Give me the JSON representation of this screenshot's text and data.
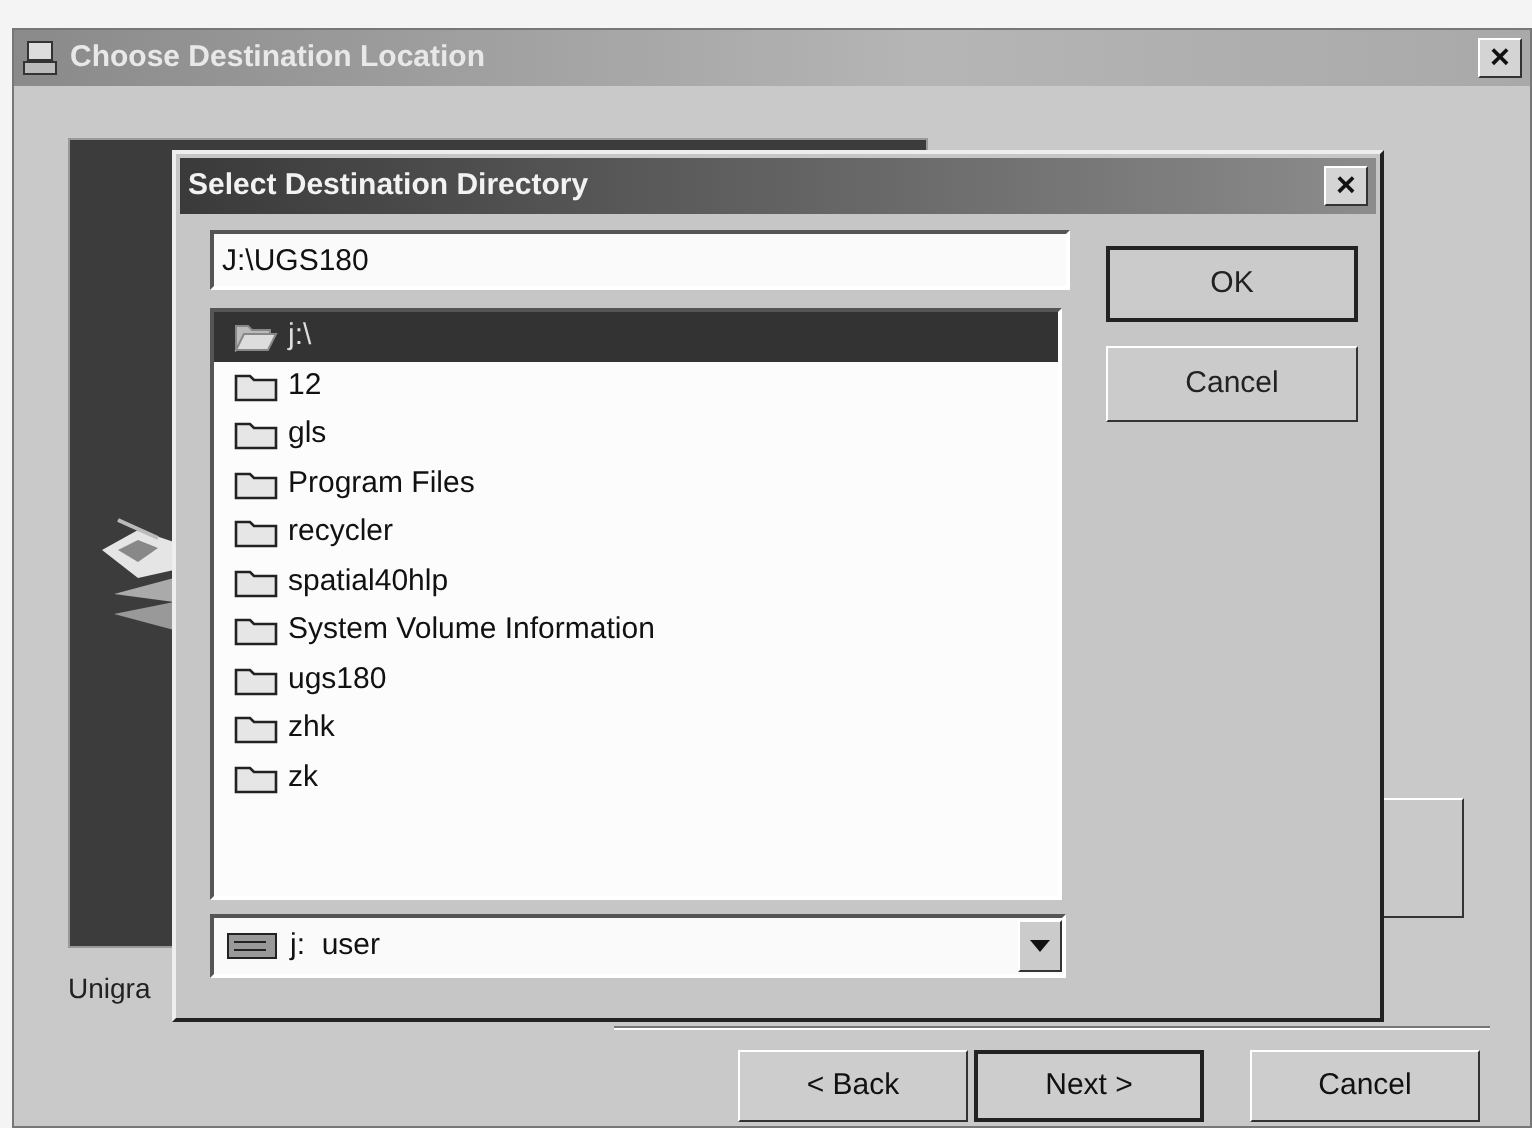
{
  "window": {
    "title": "Choose Destination Location",
    "close": "×"
  },
  "installer": {
    "caption": "Unigra",
    "buttons": [
      {
        "label": "< Back",
        "default": false
      },
      {
        "label": "Next >",
        "default": true
      },
      {
        "label": "Cancel",
        "default": false
      }
    ]
  },
  "dialog": {
    "title": "Select Destination Directory",
    "close": "×",
    "path": "J:\\UGS180",
    "buttons": [
      {
        "label": "OK",
        "default": true
      },
      {
        "label": "Cancel",
        "default": false
      }
    ],
    "folders": [
      {
        "name": "j:\\",
        "selected": true,
        "children": [
          {
            "name": "12",
            "selected": false
          },
          {
            "name": "gls",
            "selected": false
          },
          {
            "name": "Program Files",
            "selected": false
          },
          {
            "name": "recycler",
            "selected": false
          },
          {
            "name": "spatial40hlp",
            "selected": false
          },
          {
            "name": "System Volume Information",
            "selected": false
          },
          {
            "name": "ugs180",
            "selected": false
          },
          {
            "name": "zhk",
            "selected": false
          },
          {
            "name": "zk",
            "selected": false
          }
        ]
      }
    ],
    "drive": "j:  user"
  }
}
